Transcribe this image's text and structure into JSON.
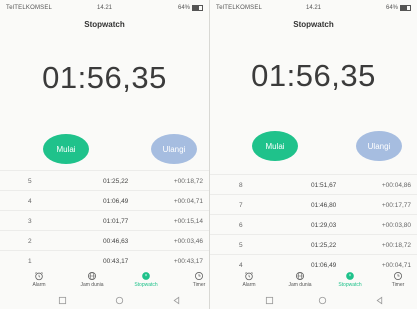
{
  "left_phone": {
    "status": {
      "carrier": "TelTELKOMSEL",
      "time": "14.21",
      "battery": "64%"
    },
    "title": "Stopwatch",
    "clock": "01:56,35",
    "buttons": {
      "start": "Mulai",
      "reset": "Ulangi"
    },
    "laps": [
      {
        "num": "5",
        "total": "01:25,22",
        "split": "+00:18,72"
      },
      {
        "num": "4",
        "total": "01:06,49",
        "split": "+00:04,71"
      },
      {
        "num": "3",
        "total": "01:01,77",
        "split": "+00:15,14"
      },
      {
        "num": "2",
        "total": "00:46,63",
        "split": "+00:03,46"
      },
      {
        "num": "1",
        "total": "00:43,17",
        "split": "+00:43,17"
      }
    ],
    "tabs": [
      "Alarm",
      "Jam dunia",
      "Stopwatch",
      "Timer"
    ]
  },
  "right_phone": {
    "status": {
      "carrier": "TelTELKOMSEL",
      "time": "14.21",
      "battery": "64%"
    },
    "title": "Stopwatch",
    "clock": "01:56,35",
    "buttons": {
      "start": "Mulai",
      "reset": "Ulangi"
    },
    "laps": [
      {
        "num": "8",
        "total": "01:51,67",
        "split": "+00:04,86"
      },
      {
        "num": "7",
        "total": "01:46,80",
        "split": "+00:17,77"
      },
      {
        "num": "6",
        "total": "01:29,03",
        "split": "+00:03,80"
      },
      {
        "num": "5",
        "total": "01:25,22",
        "split": "+00:18,72"
      },
      {
        "num": "4",
        "total": "01:06,49",
        "split": "+00:04,71"
      }
    ],
    "tabs": [
      "Alarm",
      "Jam dunia",
      "Stopwatch",
      "Timer"
    ]
  },
  "colors": {
    "accent": "#1fc28b",
    "reset_button": "#a6bde0"
  },
  "icons": {
    "tabs": [
      "alarm-clock-icon",
      "globe-icon",
      "stopwatch-icon",
      "timer-icon"
    ],
    "nav": [
      "nav-back-icon",
      "nav-home-icon",
      "nav-recents-icon"
    ]
  }
}
